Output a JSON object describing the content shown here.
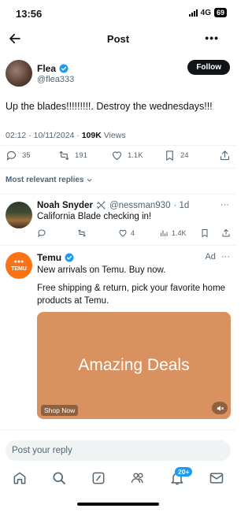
{
  "status_bar": {
    "time": "13:56",
    "network": "4G",
    "battery": "69"
  },
  "header": {
    "title": "Post",
    "more": "•••"
  },
  "post": {
    "author_name": "Flea",
    "author_handle": "@flea333",
    "follow_label": "Follow",
    "text": "Up the blades!!!!!!!!!.  Destroy the wednesdays!!!",
    "time": "02:12 · 10/11/2024 · ",
    "views_count": "109K",
    "views_label": " Views",
    "replies": "35",
    "reposts": "191",
    "likes": "1.1K",
    "bookmarks": "24"
  },
  "replies_sort": {
    "label": "Most relevant replies"
  },
  "reply": {
    "name": "Noah Snyder",
    "handle": "@nessman930",
    "age": "· 1d",
    "text": "California Blade checking in!",
    "likes": "4",
    "views": "1.4K"
  },
  "ad": {
    "logo_text": "TEMU",
    "name": "Temu",
    "label": "Ad",
    "more": "···",
    "line1": "New arrivals on Temu. Buy now.",
    "line2": "Free shipping & return, pick your favorite home products at Temu.",
    "media_text": "Amazing Deals",
    "shop_now": "Shop Now"
  },
  "compose": {
    "placeholder": "Post your reply"
  },
  "nav": {
    "notifications_badge": "20+"
  },
  "colors": {
    "accent": "#1d9bf0",
    "ad_media": "#d9915f",
    "temu_orange": "#f97316"
  }
}
